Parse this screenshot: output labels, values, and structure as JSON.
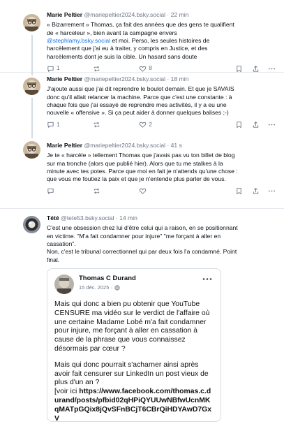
{
  "posts": [
    {
      "author": "Marie Peltier",
      "handle": "@mariepeltier2024.bsky.social",
      "time": "· 22 min",
      "lines": [
        "« Bizarrement » Thomas, ça fait des années que des gens te qualifient",
        "de « harceleur », bien avant ta campagne envers",
        "",
        "harcèlement que j'ai eu à traiter, y compris en Justice, et des",
        "harcèlements dont je suis la cible. Un hasard sans doute"
      ],
      "mention": "@stephlamy.bsky.social",
      "mention_suffix": " et moi. Perso, les seules histoires de",
      "replies": "1",
      "likes": "8"
    },
    {
      "author": "Marie Peltier",
      "handle": "@mariepeltier2024.bsky.social",
      "time": "· 18 min",
      "lines": [
        "J'ajoute aussi que j'ai dit reprendre le boulot demain. Et que je SAVAIS",
        "donc qu'il allait relancer la machine. Parce que c'est une constante : à",
        "chaque fois que j'ai essayé de reprendre mes activités, il y a eu une",
        "nouvelle « offensive ». Si ça peut aider à donner quelques balises ;-)"
      ],
      "replies": "1",
      "likes": "2"
    },
    {
      "author": "Marie Peltier",
      "handle": "@mariepeltier2024.bsky.social",
      "time": "· 41 s",
      "lines": [
        "Je te « harcèle » tellement Thomas que j'avais pas vu ton billet de blog",
        "sur ma tronche (alors que publié hier). Alors que tu me stalkes à la",
        "minute avec tes potes. Parce que moi en fait je n'attends qu'une chose :",
        "que vous me foutiez la paix et que je n'entende plus parler de vous."
      ]
    },
    {
      "author": "Tété",
      "handle": "@tete53.bsky.social",
      "time": "· 14 min",
      "lines": [
        "C'est une obsession chez lui d'être celui qui a raison, en se positionnant",
        "en victime. \"M'a fait condamner pour injure\" \"me forçant à aller en",
        "cassation\".",
        "Non, c'est le tribunal correctionnel qui par deux fois l'a condamné. Point",
        "final."
      ]
    }
  ],
  "embed": {
    "author": "Thomas C Durand",
    "date": "15 déc. 2025 ·",
    "para1": "Mais qui donc a bien pu obtenir que YouTube CENSURE ma vidéo sur le verdict de l'affaire où une certaine Madame Lobé m'a fait condamner pour injure, me forçant à aller en cassation à cause de la phrase que vous connaissez désormais par cœur ?",
    "para2": "Mais qui donc pourrait s'acharner ainsi après avoir fait censurer sur LinkedIn un post vieux de plus d'un an ?",
    "link_prefix": "[voir ici ",
    "link": "https://www.facebook.com/thomas.c.durand/posts/pfbid02qHPiQYUUwNBfwUcnMKqMATpGQix8jQvSFnBCjT6CBrQiHDYAwD7GxV"
  },
  "colors": {
    "link": "#1a73e8",
    "muted": "#6b7684",
    "divider": "#e6e9ee"
  }
}
